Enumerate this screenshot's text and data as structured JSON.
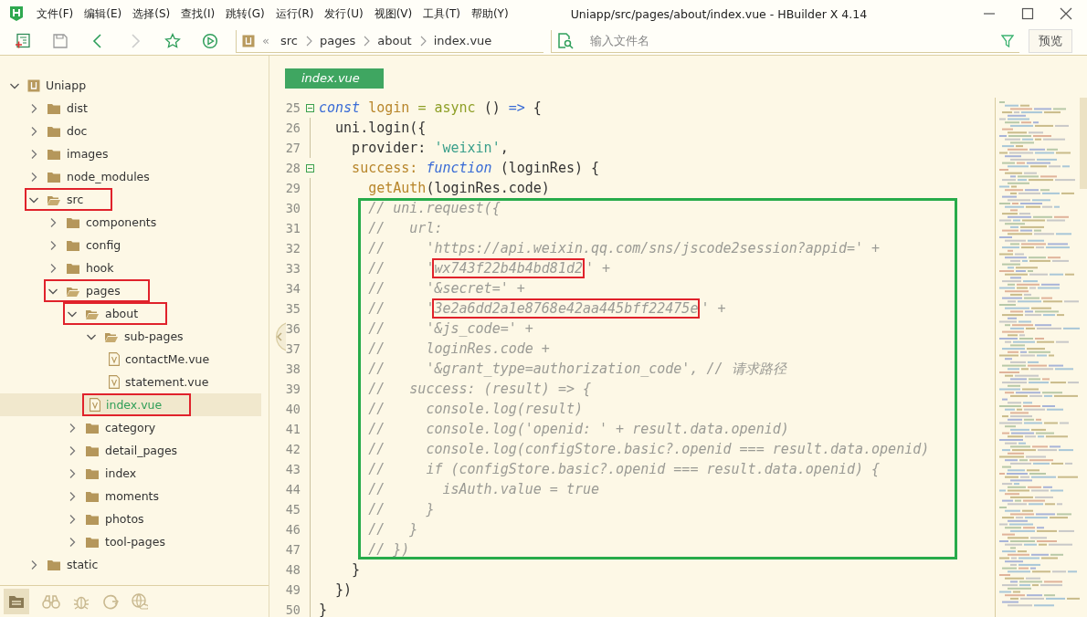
{
  "window": {
    "title": "Uniapp/src/pages/about/index.vue - HBuilder X 4.14"
  },
  "menu": [
    "文件(F)",
    "编辑(E)",
    "选择(S)",
    "查找(I)",
    "跳转(G)",
    "运行(R)",
    "发行(U)",
    "视图(V)",
    "工具(T)",
    "帮助(Y)"
  ],
  "breadcrumb": {
    "overflow": "«",
    "items": [
      "src",
      "pages",
      "about",
      "index.vue"
    ]
  },
  "file_search": {
    "placeholder": "输入文件名"
  },
  "preview_button": "预览",
  "tree": [
    {
      "label": "Uniapp",
      "kind": "project",
      "expanded": true,
      "selected": false,
      "annotated": false,
      "children": [
        {
          "label": "dist",
          "kind": "folder",
          "expanded": false,
          "selected": false,
          "annotated": false
        },
        {
          "label": "doc",
          "kind": "folder",
          "expanded": false,
          "selected": false,
          "annotated": false
        },
        {
          "label": "images",
          "kind": "folder",
          "expanded": false,
          "selected": false,
          "annotated": false
        },
        {
          "label": "node_modules",
          "kind": "folder",
          "expanded": false,
          "selected": false,
          "annotated": false
        },
        {
          "label": "src",
          "kind": "folder",
          "expanded": true,
          "selected": false,
          "annotated": true,
          "children": [
            {
              "label": "components",
              "kind": "folder",
              "expanded": false,
              "selected": false,
              "annotated": false
            },
            {
              "label": "config",
              "kind": "folder",
              "expanded": false,
              "selected": false,
              "annotated": false
            },
            {
              "label": "hook",
              "kind": "folder",
              "expanded": false,
              "selected": false,
              "annotated": false
            },
            {
              "label": "pages",
              "kind": "folder",
              "expanded": true,
              "selected": false,
              "annotated": true,
              "children": [
                {
                  "label": "about",
                  "kind": "folder",
                  "expanded": true,
                  "selected": false,
                  "annotated": true,
                  "children": [
                    {
                      "label": "sub-pages",
                      "kind": "folder",
                      "expanded": true,
                      "selected": false,
                      "annotated": false,
                      "children": [
                        {
                          "label": "contactMe.vue",
                          "kind": "file",
                          "selected": false,
                          "annotated": false
                        },
                        {
                          "label": "statement.vue",
                          "kind": "file",
                          "selected": false,
                          "annotated": false
                        }
                      ]
                    },
                    {
                      "label": "index.vue",
                      "kind": "file",
                      "selected": true,
                      "annotated": true
                    }
                  ]
                },
                {
                  "label": "category",
                  "kind": "folder",
                  "expanded": false,
                  "selected": false,
                  "annotated": false
                },
                {
                  "label": "detail_pages",
                  "kind": "folder",
                  "expanded": false,
                  "selected": false,
                  "annotated": false
                },
                {
                  "label": "index",
                  "kind": "folder",
                  "expanded": false,
                  "selected": false,
                  "annotated": false
                },
                {
                  "label": "moments",
                  "kind": "folder",
                  "expanded": false,
                  "selected": false,
                  "annotated": false
                },
                {
                  "label": "photos",
                  "kind": "folder",
                  "expanded": false,
                  "selected": false,
                  "annotated": false
                },
                {
                  "label": "tool-pages",
                  "kind": "folder",
                  "expanded": false,
                  "selected": false,
                  "annotated": false
                }
              ]
            }
          ]
        },
        {
          "label": "static",
          "kind": "folder",
          "expanded": false,
          "selected": false,
          "annotated": false
        }
      ]
    }
  ],
  "editor_tabs": [
    {
      "label": "index.vue",
      "selected": true
    }
  ],
  "code_sections": [
    {
      "annotated": false,
      "lines": [
        {
          "no": "25",
          "fold": true,
          "tokens": [
            {
              "kind": "keyword",
              "t": "const "
            },
            {
              "kind": "name",
              "t": "login "
            },
            {
              "kind": "builtin",
              "t": "= async "
            },
            {
              "kind": "plain",
              "t": "() "
            },
            {
              "kind": "operator",
              "t": "=>"
            },
            {
              "kind": "plain",
              "t": " {"
            }
          ]
        },
        {
          "no": "26",
          "fold": false,
          "tokens": [
            {
              "kind": "plain",
              "t": "  uni.login({"
            }
          ]
        },
        {
          "no": "27",
          "fold": false,
          "tokens": [
            {
              "kind": "plain",
              "t": "    provider: "
            },
            {
              "kind": "string",
              "t": "'weixin'"
            },
            {
              "kind": "plain",
              "t": ","
            }
          ]
        },
        {
          "no": "28",
          "fold": true,
          "tokens": [
            {
              "kind": "name",
              "t": "    success: "
            },
            {
              "kind": "keyword",
              "t": "function"
            },
            {
              "kind": "plain",
              "t": " (loginRes) {"
            }
          ]
        },
        {
          "no": "29",
          "fold": false,
          "tokens": [
            {
              "kind": "name",
              "t": "      getAuth"
            },
            {
              "kind": "plain",
              "t": "(loginRes.code)"
            }
          ]
        }
      ]
    },
    {
      "annotated": true,
      "lines": [
        {
          "no": "30",
          "fold": false,
          "tokens": [
            {
              "kind": "comment",
              "t": "      // uni.request({"
            }
          ]
        },
        {
          "no": "31",
          "fold": false,
          "tokens": [
            {
              "kind": "comment",
              "t": "      //   url:"
            }
          ]
        },
        {
          "no": "32",
          "fold": false,
          "tokens": [
            {
              "kind": "comment",
              "t": "      //     'https://api.weixin.qq.com/sns/jscode2session?appid=' +"
            }
          ]
        },
        {
          "no": "33",
          "fold": false,
          "tokens": [
            {
              "kind": "comment",
              "t": "      //     '"
            },
            {
              "kind": "boxed",
              "t": "wx743f22b4b4bd81d2"
            },
            {
              "kind": "comment",
              "t": "' +"
            }
          ]
        },
        {
          "no": "34",
          "fold": false,
          "tokens": [
            {
              "kind": "comment",
              "t": "      //     '&secret=' +"
            }
          ]
        },
        {
          "no": "35",
          "fold": false,
          "tokens": [
            {
              "kind": "comment",
              "t": "      //     '"
            },
            {
              "kind": "boxed",
              "t": "3e2a6dd2a1e8768e42aa445bff22475e"
            },
            {
              "kind": "comment",
              "t": "' +"
            }
          ]
        },
        {
          "no": "36",
          "fold": false,
          "tokens": [
            {
              "kind": "comment",
              "t": "      //     '&js_code=' +"
            }
          ]
        },
        {
          "no": "37",
          "fold": false,
          "tokens": [
            {
              "kind": "comment",
              "t": "      //     loginRes.code +"
            }
          ]
        },
        {
          "no": "38",
          "fold": false,
          "tokens": [
            {
              "kind": "comment",
              "t": "      //     '&grant_type=authorization_code', // 请求路径"
            }
          ]
        },
        {
          "no": "39",
          "fold": false,
          "tokens": [
            {
              "kind": "comment",
              "t": "      //   success: (result) => {"
            }
          ]
        },
        {
          "no": "40",
          "fold": false,
          "tokens": [
            {
              "kind": "comment",
              "t": "      //     console.log(result)"
            }
          ]
        },
        {
          "no": "41",
          "fold": false,
          "tokens": [
            {
              "kind": "comment",
              "t": "      //     console.log('openid: ' + result.data.openid)"
            }
          ]
        },
        {
          "no": "42",
          "fold": false,
          "tokens": [
            {
              "kind": "comment",
              "t": "      //     console.log(configStore.basic?.openid === result.data.openid)"
            }
          ]
        },
        {
          "no": "43",
          "fold": false,
          "tokens": [
            {
              "kind": "comment",
              "t": "      //     if (configStore.basic?.openid === result.data.openid) {"
            }
          ]
        },
        {
          "no": "44",
          "fold": false,
          "tokens": [
            {
              "kind": "comment",
              "t": "      //       isAuth.value = true"
            }
          ]
        },
        {
          "no": "45",
          "fold": false,
          "tokens": [
            {
              "kind": "comment",
              "t": "      //     }"
            }
          ]
        },
        {
          "no": "46",
          "fold": false,
          "tokens": [
            {
              "kind": "comment",
              "t": "      //   }"
            }
          ]
        },
        {
          "no": "47",
          "fold": false,
          "tokens": [
            {
              "kind": "comment",
              "t": "      // })"
            }
          ]
        }
      ]
    },
    {
      "annotated": false,
      "lines": [
        {
          "no": "48",
          "fold": false,
          "tokens": [
            {
              "kind": "plain",
              "t": "    }"
            }
          ]
        },
        {
          "no": "49",
          "fold": false,
          "tokens": [
            {
              "kind": "plain",
              "t": "  })"
            }
          ]
        },
        {
          "no": "50",
          "fold": false,
          "tokens": [
            {
              "kind": "plain",
              "t": "}"
            }
          ]
        }
      ]
    }
  ]
}
